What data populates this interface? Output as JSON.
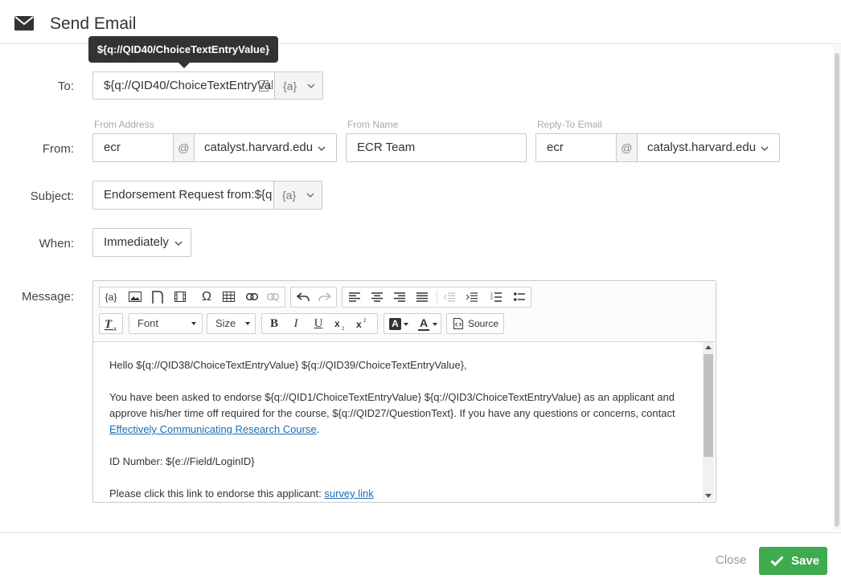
{
  "header": {
    "title": "Send Email",
    "icon": "envelope-icon"
  },
  "tooltip": {
    "text": "${q://QID40/ChoiceTextEntryValue}"
  },
  "to": {
    "label": "To:",
    "value": "${q://QID40/ChoiceTextEntryValue}",
    "piped_text_label": "{a}"
  },
  "from": {
    "label": "From:",
    "address_label": "From Address",
    "address_user": "ecr",
    "at_symbol": "@",
    "address_domain": "catalyst.harvard.edu",
    "name_label": "From Name",
    "name_value": "ECR Team",
    "reply_label": "Reply-To Email",
    "reply_user": "ecr",
    "reply_domain": "catalyst.harvard.edu"
  },
  "subject": {
    "label": "Subject:",
    "value": "Endorsement Request from:${q",
    "piped_text_label": "{a}"
  },
  "when": {
    "label": "When:",
    "value": "Immediately"
  },
  "message": {
    "label": "Message:",
    "toolbar": {
      "piped": "{a}",
      "font": "Font",
      "size": "Size",
      "bold": "B",
      "italic": "I",
      "underline": "U",
      "source": "Source",
      "omega": "Ω",
      "text_color": "A",
      "bg_color": "A"
    },
    "body": {
      "greeting": "Hello ${q://QID38/ChoiceTextEntryValue} ${q://QID39/ChoiceTextEntryValue},",
      "para1_before": "You have been asked to endorse ${q://QID1/ChoiceTextEntryValue} ${q://QID3/ChoiceTextEntryValue} as an applicant and approve his/her time off required for the course, ${q://QID27/QuestionText}. If you have any questions or concerns, contact ",
      "para1_link": "Effectively Communicating Research Course",
      "para1_after": ".",
      "id_line": "ID Number:  ${e://Field/LoginID}",
      "link_line_before": "Please click this link to endorse this applicant: ",
      "link_line_link": "survey link"
    }
  },
  "footer": {
    "close": "Close",
    "save": "Save"
  },
  "colors": {
    "save_green": "#3fab4f",
    "link_blue": "#1a6eb7"
  }
}
